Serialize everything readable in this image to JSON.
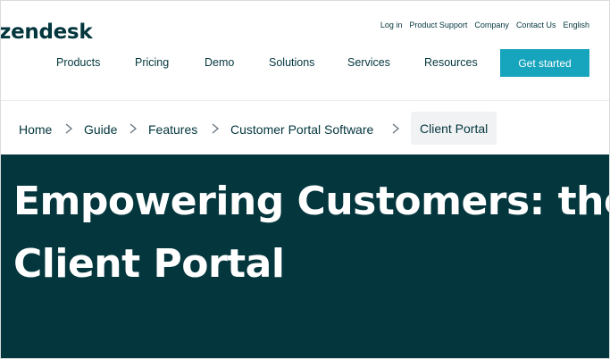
{
  "header": {
    "logo": "zendesk",
    "utility_links": [
      "Log in",
      "Product Support",
      "Company",
      "Contact Us",
      "English"
    ],
    "nav": [
      "Products",
      "Pricing",
      "Demo",
      "Solutions",
      "Services",
      "Resources"
    ],
    "cta_label": "Get started"
  },
  "breadcrumb": {
    "items": [
      "Home",
      "Guide",
      "Features",
      "Customer Portal Software"
    ],
    "current": "Client Portal"
  },
  "hero": {
    "title_line1": "Empowering Customers: the",
    "title_line2": "Client Portal"
  },
  "colors": {
    "brand_dark": "#03363d",
    "accent": "#17a4bd"
  }
}
